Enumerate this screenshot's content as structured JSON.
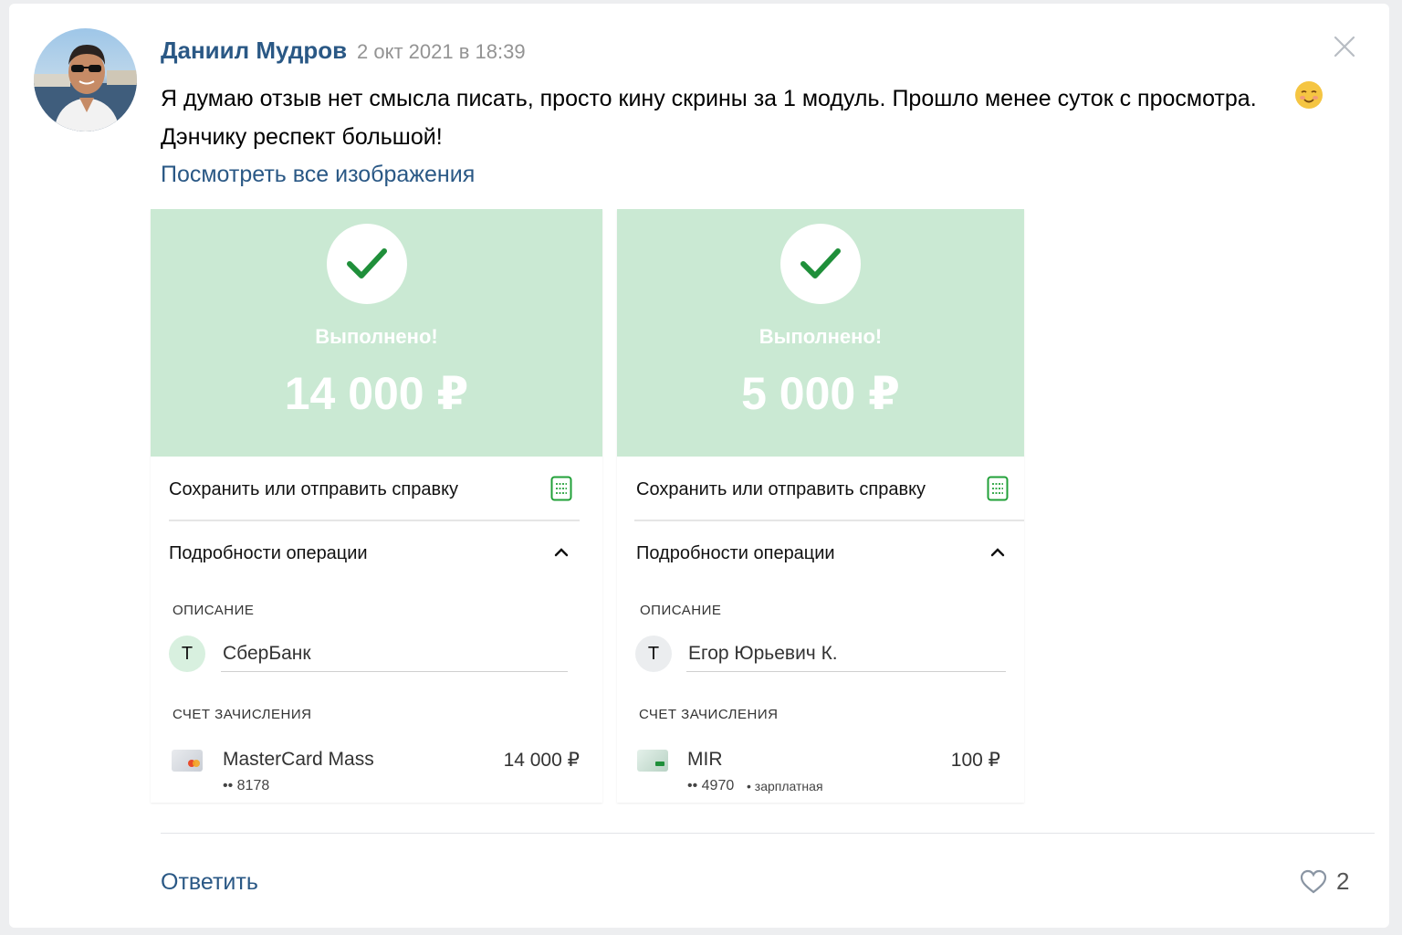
{
  "post": {
    "author": "Даниил Мудров",
    "date": "2 окт 2021 в 18:39",
    "text_line1": "Я думаю отзыв нет смысла писать, просто кину скрины за 1 модуль. Прошло менее суток с просмотра.",
    "text_line2": "Дэнчику респект большой!",
    "view_all": "Посмотреть все изображения"
  },
  "receipts": [
    {
      "status": "Выполнено!",
      "amount": "14 000 ₽",
      "save_label": "Сохранить или отправить справку",
      "details_label": "Подробности операции",
      "description_header": "ОПИСАНИЕ",
      "desc_letter": "Т",
      "description": "СберБанк",
      "account_header": "СЧЕТ ЗАЧИСЛЕНИЯ",
      "account_name": "MasterCard Mass",
      "account_sum": "14 000 ₽",
      "account_number": "•• 8178"
    },
    {
      "status": "Выполнено!",
      "amount": "5 000 ₽",
      "save_label": "Сохранить или отправить справку",
      "details_label": "Подробности операции",
      "description_header": "ОПИСАНИЕ",
      "desc_letter": "Т",
      "description": "Егор Юрьевич К.",
      "account_header": "СЧЕТ ЗАЧИСЛЕНИЯ",
      "account_name": "MIR",
      "account_sum": "100 ₽",
      "account_number": "•• 4970",
      "account_note": "• зарплатная"
    }
  ],
  "footer": {
    "reply": "Ответить",
    "likes": "2"
  },
  "colors": {
    "link": "#2a5885",
    "success_banner": "#cae9d3",
    "check": "#1f8f3a",
    "icon_green": "#21a038"
  },
  "icons": [
    "close-icon",
    "check-icon",
    "receipt-doc-icon",
    "chevron-up-icon",
    "card-icon",
    "heart-icon",
    "smile-emoji-icon"
  ]
}
